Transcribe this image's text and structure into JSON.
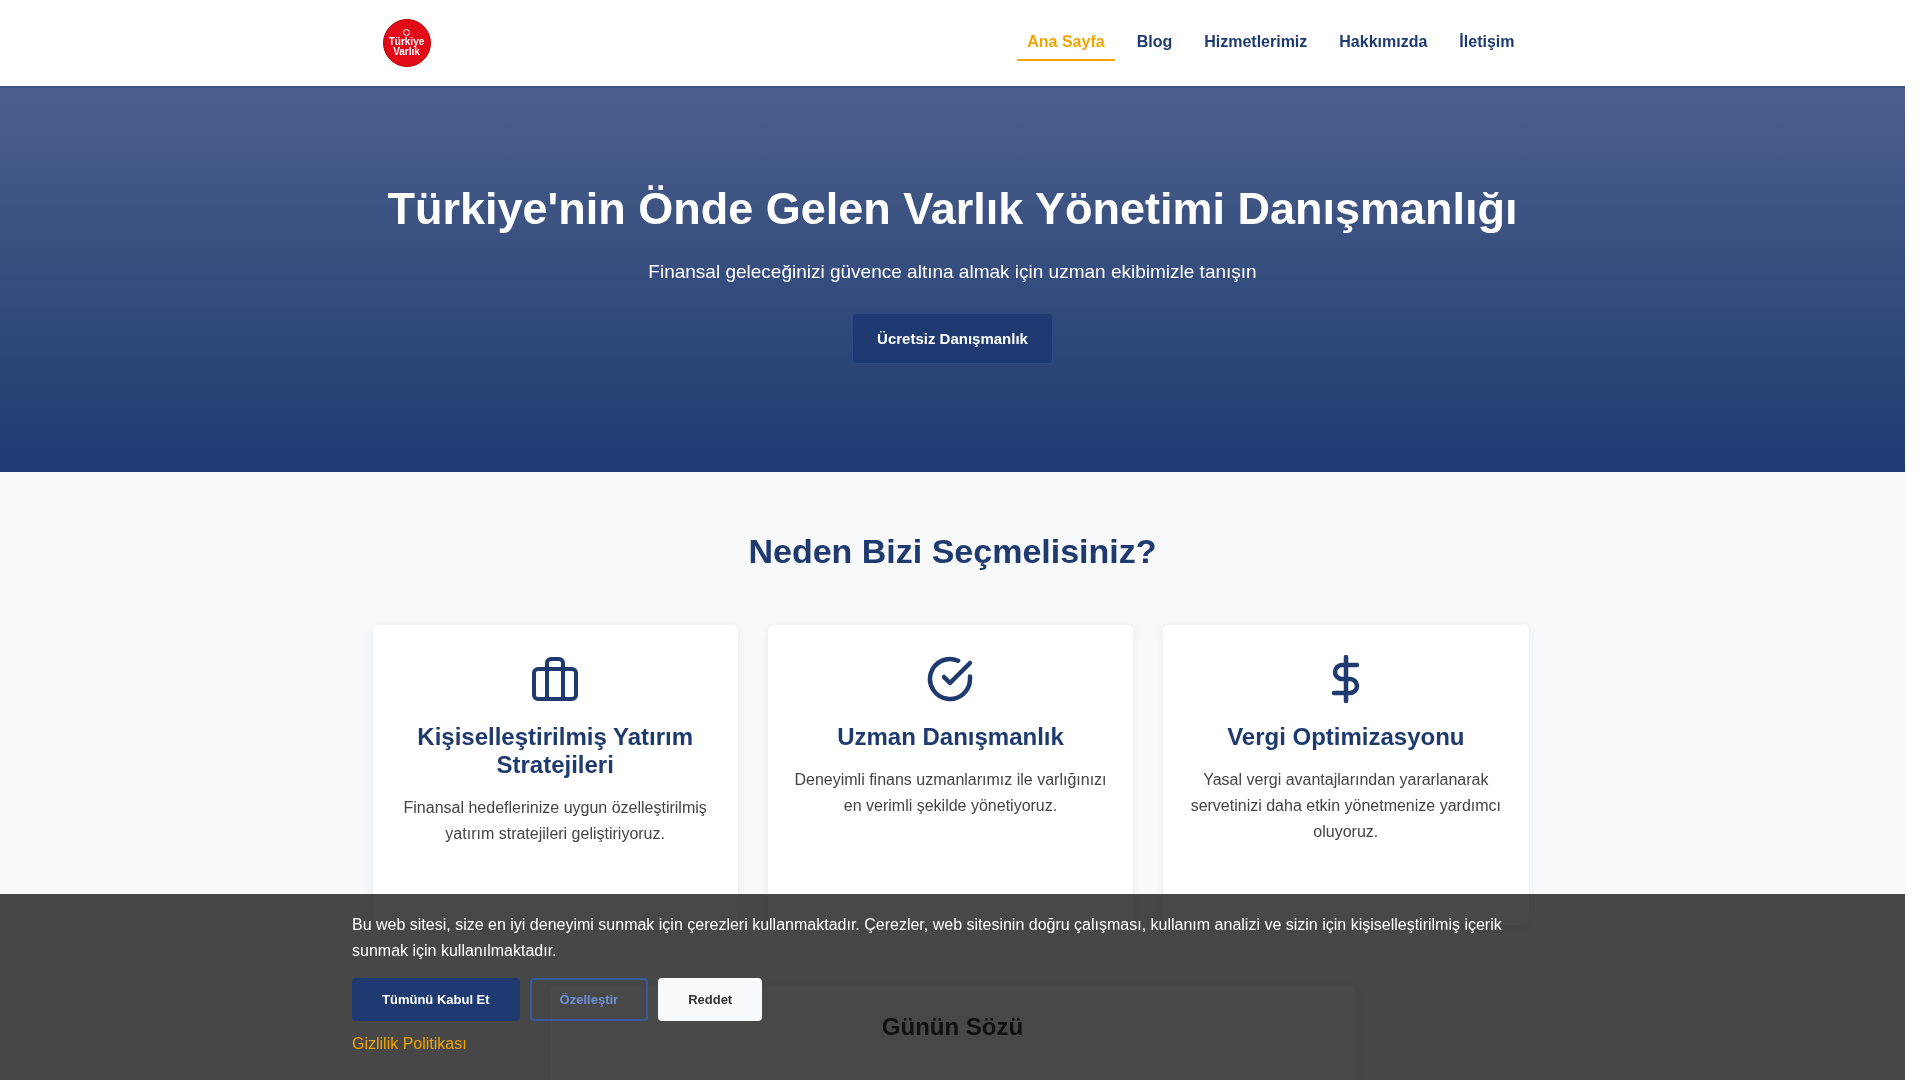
{
  "header": {
    "logo": {
      "line_1": "Türkiye",
      "line_2": "Varlık"
    },
    "nav": [
      {
        "label": "Ana Sayfa",
        "selected": true
      },
      {
        "label": "Blog",
        "selected": false
      },
      {
        "label": "Hizmetlerimiz",
        "selected": false
      },
      {
        "label": "Hakkımızda",
        "selected": false
      },
      {
        "label": "İletişim",
        "selected": false
      }
    ]
  },
  "hero": {
    "title": "Türkiye'nin Önde Gelen Varlık Yönetimi Danışmanlığı",
    "subtitle": "Finansal geleceğinizi güvence altına almak için uzman ekibimizle tanışın",
    "button": "Ücretsiz Danışmanlık"
  },
  "features": {
    "title": "Neden Bizi Seçmelisiniz?",
    "cards": [
      {
        "kind": "briefcase",
        "title": "Kişiselleştirilmiş Yatırım Stratejileri",
        "text": "Finansal hedeflerinize uygun özelleştirilmiş yatırım stratejileri geliştiriyoruz."
      },
      {
        "kind": "check",
        "title": "Uzman Danışmanlık",
        "text": "Deneyimli finans uzmanlarımız ile varlığınızı en verimli şekilde yönetiyoruz."
      },
      {
        "kind": "dollar",
        "title": "Vergi Optimizasyonu",
        "text": "Yasal vergi avantajlarından yararlanarak servetinizi daha etkin yönetmenize yardımcı oluyoruz."
      }
    ]
  },
  "quote_section": {
    "title": "Günün Sözü"
  },
  "cookie_banner": {
    "text": "Bu web sitesi, size en iyi deneyimi sunmak için çerezleri kullanmaktadır. Çerezler, web sitesinin doğru çalışması, kullanım analizi ve sizin için kişiselleştirilmiş içerik sunmak için kullanılmaktadır.",
    "buttons": [
      {
        "kind": "primary",
        "label": "Tümünü Kabul Et"
      },
      {
        "kind": "outline",
        "label": "Özelleştir"
      },
      {
        "kind": "light",
        "label": "Reddet"
      }
    ],
    "link": "Gizlilik Politikası"
  }
}
